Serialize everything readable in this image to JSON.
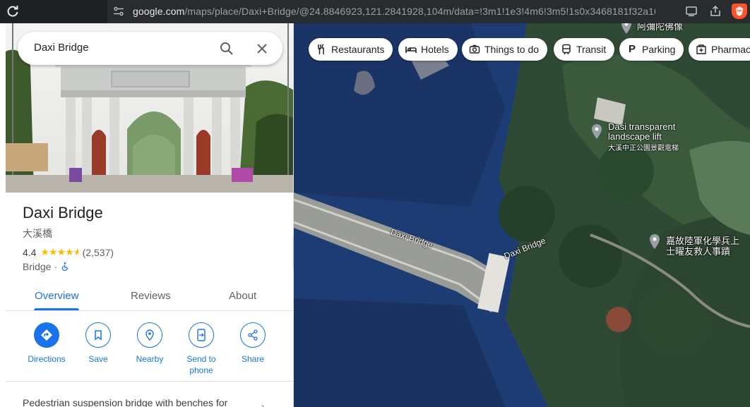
{
  "browser": {
    "url_host": "google.com",
    "url_path": "/maps/place/Daxi+Bridge/@24.8846923,121.2841928,104m/data=!3m1!1e3!4m6!3m5!1s0x3468181f32a10bed:..."
  },
  "search": {
    "value": "Daxi Bridge"
  },
  "place": {
    "name": "Daxi Bridge",
    "native_name": "大溪橋",
    "rating": "4.4",
    "rating_stars": 4.4,
    "review_count": "(2,537)",
    "category": "Bridge",
    "separator": "·",
    "description": "Pedestrian suspension bridge with benches for"
  },
  "tabs": [
    {
      "label": "Overview"
    },
    {
      "label": "Reviews"
    },
    {
      "label": "About"
    }
  ],
  "actions": [
    {
      "label": "Directions",
      "icon": "directions-icon"
    },
    {
      "label": "Save",
      "icon": "bookmark-icon"
    },
    {
      "label": "Nearby",
      "icon": "nearby-icon"
    },
    {
      "label": "Send to phone",
      "icon": "send-to-phone-icon"
    },
    {
      "label": "Share",
      "icon": "share-icon"
    }
  ],
  "chips": [
    {
      "label": "Restaurants",
      "icon": "fork-knife-icon"
    },
    {
      "label": "Hotels",
      "icon": "bed-icon"
    },
    {
      "label": "Things to do",
      "icon": "camera-icon"
    },
    {
      "label": "Transit",
      "icon": "train-icon"
    },
    {
      "label": "Parking",
      "icon": "parking-icon"
    },
    {
      "label": "Pharmac",
      "icon": "pharmacy-icon"
    }
  ],
  "map_labels": {
    "bridge_1": "Daxi Bridge",
    "bridge_2": "Daxi Bridge",
    "lift_line1": "Dasi transparent",
    "lift_line2": "landscape lift",
    "lift_native": "大溪中正公園景觀電梯",
    "memorial_line1": "嘉故陸軍化學兵上",
    "memorial_line2": "士曜友救人事蹟",
    "top_partial": "阿彌陀佛像"
  },
  "colors": {
    "accent": "#1a73e8",
    "star": "#fbbc04",
    "browser_bar": "#202124"
  }
}
